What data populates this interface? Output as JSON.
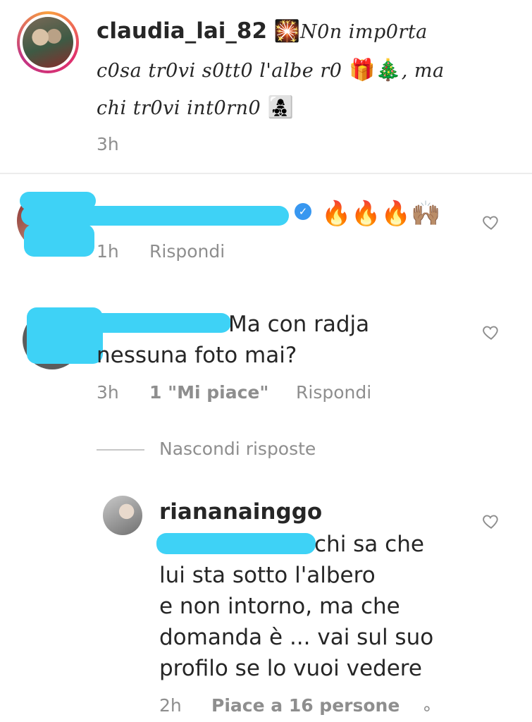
{
  "caption": {
    "username": "claudia_lai_82",
    "line1_emoji": "🎇",
    "line1_text": "N0n imp0rta",
    "line2_text": "c0sa tr0vi s0tt0 l'albe r0",
    "line2_emoji": "🎁🎄",
    "line2_tail": ", ma",
    "line3_text": "chi tr0vi int0rn0",
    "line3_emoji": "👩‍👧‍👦",
    "time": "3h"
  },
  "comments": [
    {
      "text": "🔥🔥🔥🙌🏽",
      "time": "1h",
      "reply_label": "Rispondi"
    },
    {
      "text_line1": "Ma con radja",
      "text_line2": "nessuna foto mai?",
      "time": "3h",
      "likes_label": "1 \"Mi piace\"",
      "reply_label": "Rispondi"
    }
  ],
  "replies_toggle": "Nascondi risposte",
  "reply": {
    "username": "riananainggo",
    "line1": "chi sa che",
    "line2": "lui sta sotto l'albero",
    "line3": "e non intorno, ma che",
    "line4": "domanda è ... vai sul suo",
    "line5": "profilo se lo vuoi vedere",
    "time": "2h",
    "likes_label": "Piace a 16 persone",
    "more": "∘"
  },
  "colors": {
    "text": "#262626",
    "meta": "#8e8e8e",
    "scribble": "#3ed2f6",
    "verified": "#3897f0"
  },
  "icons": [
    "heart-outline-icon",
    "verified-badge-icon"
  ]
}
